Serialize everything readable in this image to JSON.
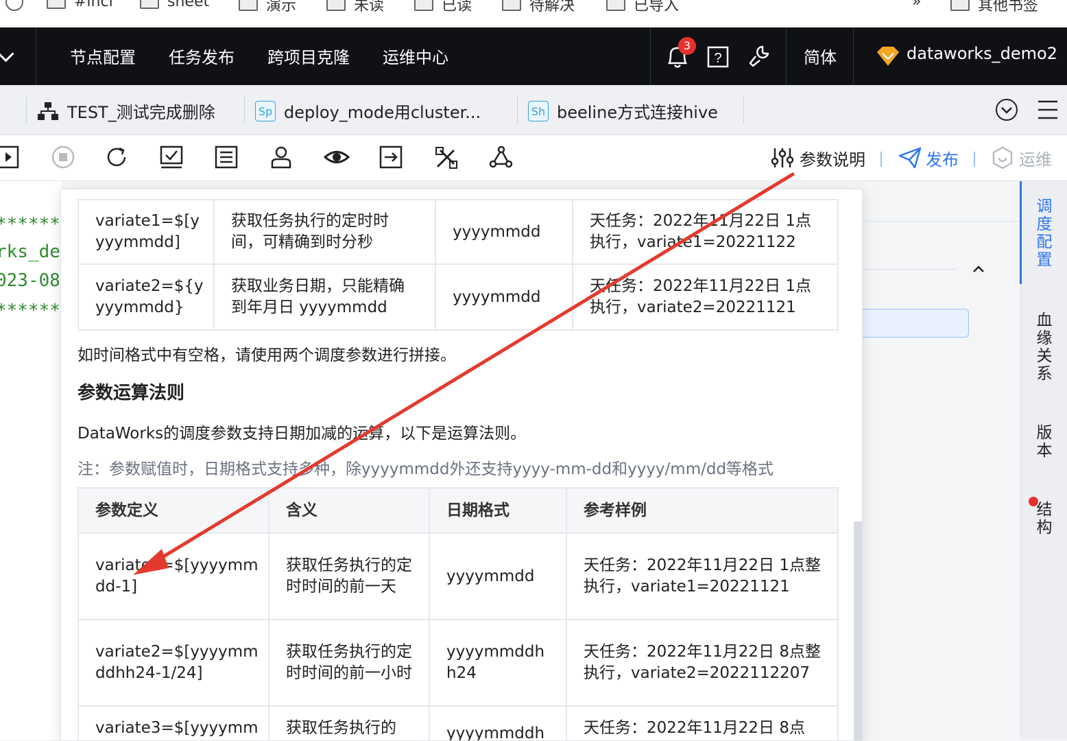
{
  "bookmarks": [
    "#inci",
    "sheet",
    "演示",
    "未读",
    "已读",
    "待解决",
    "已导入",
    "其他书签"
  ],
  "bookmarks_overflow": "»",
  "topnav": {
    "items": [
      "节点配置",
      "任务发布",
      "跨项目克隆",
      "运维中心"
    ],
    "notification_count": "3",
    "language": "简体",
    "user": "dataworks_demo2"
  },
  "tabs": [
    {
      "label": "TEST_测试完成删除",
      "icon": "workflow-icon"
    },
    {
      "label": "deploy_mode用cluster...",
      "icon": "Sp"
    },
    {
      "label": "beeline方式连接hive",
      "icon": "Sh"
    }
  ],
  "toolbar": {
    "param_help": "参数说明",
    "publish": "发布",
    "ops": "运维"
  },
  "editor_lines": [
    "******",
    "rks_de",
    "023-08",
    "******"
  ],
  "sidebar": {
    "tabs": [
      "调度配置",
      "血缘关系",
      "版本",
      "结构"
    ]
  },
  "popup": {
    "top_table": {
      "rows": [
        [
          "variate1=$[y yyymmdd]",
          "获取任务执行的定时时间，可精确到时分秒",
          "yyyymmdd",
          "天任务：2022年11月22日 1点执行，variate1=20221122"
        ],
        [
          "variate2=${y yyymmdd}",
          "获取业务日期，只能精确到年月日 yyyymmdd",
          "yyyymmdd",
          "天任务：2022年11月22日 1点执行，variate2=20221121"
        ]
      ]
    },
    "space_note": "如时间格式中有空格，请使用两个调度参数进行拼接。",
    "section_title": "参数运算法则",
    "section_desc": "DataWorks的调度参数支持日期加减的运算，以下是运算法则。",
    "note": "注：参数赋值时，日期格式支持多种，除yyyymmdd外还支持yyyy-mm-dd和yyyy/mm/dd等格式",
    "ops_table": {
      "headers": [
        "参数定义",
        "含义",
        "日期格式",
        "参考样例"
      ],
      "rows": [
        [
          "variate1=$[yyyymm dd-1]",
          "获取任务执行的定时时间的前一天",
          "yyyymmdd",
          "天任务：2022年11月22日 1点整执行，variate1=20221121"
        ],
        [
          "variate2=$[yyyymm ddhh24-1/24]",
          "获取任务执行的定时时间的前一小时",
          "yyyymmddh h24",
          "天任务：2022年11月22日 8点整执行，variate2=2022112207"
        ],
        [
          "variate3=$[yyyymm",
          "获取任务执行的",
          "yyyymmddh",
          "天任务：2022年11月22日 8点"
        ]
      ]
    }
  },
  "colors": {
    "accent": "#2f78e6",
    "arrow": "#e23b2e",
    "topnav_bg": "#0f1115",
    "badge": "#e6322e"
  }
}
